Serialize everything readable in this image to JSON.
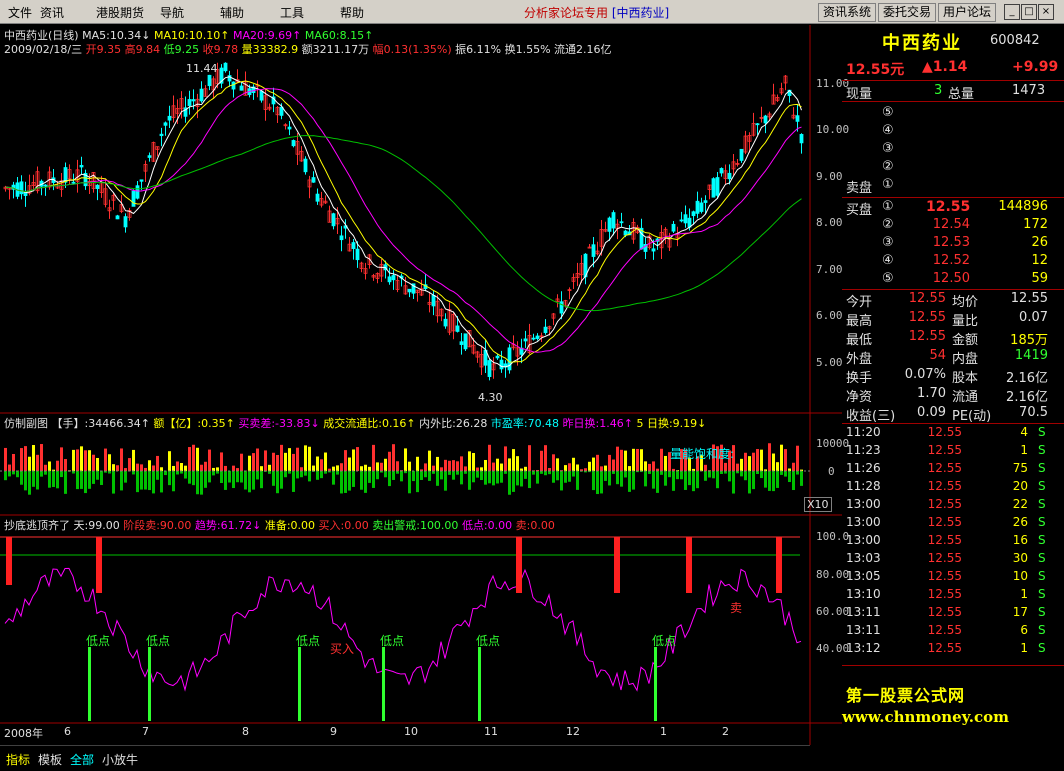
{
  "menu": {
    "items": [
      "文件",
      "资讯",
      "港股期货",
      "导航",
      "辅助",
      "工具",
      "帮助"
    ],
    "center_title": "分析家论坛专用",
    "center_stock": "[中西药业]",
    "buttons": [
      "资讯系统",
      "委托交易",
      "用户论坛"
    ]
  },
  "stock": {
    "name": "中西药业",
    "code": "600842",
    "price": "12.55元",
    "change": "▲1.14",
    "pct": "+9.99"
  },
  "chart_header": {
    "title": "中西药业(日线)",
    "ma5": "MA5:10.34↓",
    "ma10": "MA10:10.10↑",
    "ma20": "MA20:9.69↑",
    "ma60": "MA60:8.15↑",
    "date_line": "2009/02/18/三",
    "open": "开9.35",
    "high": "高9.84",
    "low": "低9.25",
    "close": "收9.78",
    "vol": "量33382.9",
    "amount": "额3211.17万",
    "range": "幅0.13(1.35%)",
    "amp": "振6.11%",
    "turn": "换1.55%",
    "flow": "流通2.16亿"
  },
  "price_annotations": {
    "high": "11.44",
    "low": "4.30"
  },
  "price_axis": [
    "11.00",
    "10.00",
    "9.00",
    "8.00",
    "7.00",
    "6.00",
    "5.00"
  ],
  "sub1": {
    "label": "仿制副图",
    "hand": "【手】:34466.34↑",
    "amt": "额【亿】:0.35↑",
    "diff": "买卖差:-33.83↓",
    "ratio": "成交流通比:0.16↑",
    "inout": "内外比:26.28",
    "pe": "市盈率:70.48",
    "yest": "昨日换:1.46↑",
    "five": "5 日换:9.19↓",
    "axis": [
      "10000",
      "0"
    ],
    "x10": "X10",
    "overlay": "量能饱和度:"
  },
  "sub2": {
    "label": "抄底逃顶齐了",
    "sky": "天:99.00",
    "stage": "阶段卖:90.00",
    "trend": "趋势:61.72↓",
    "prep": "准备:0.00",
    "buy": "买入:0.00",
    "warn": "卖出警戒:100.00",
    "low": "低点:0.00",
    "sell": "卖:0.00",
    "axis": [
      "100.0",
      "80.00",
      "60.00",
      "40.00"
    ],
    "lowpt": "低点",
    "buyin": "买入",
    "sellw": "卖"
  },
  "xaxis": [
    "2008年",
    "6",
    "7",
    "8",
    "9",
    "10",
    "11",
    "12",
    "1",
    "2"
  ],
  "tabs": [
    "指标",
    "模板",
    "全部",
    "小放牛"
  ],
  "quote": {
    "now_vol_label": "现量",
    "now_vol": "3",
    "total_label": "总量",
    "total": "1473",
    "sell": [
      {
        "n": "⑤"
      },
      {
        "n": "④"
      },
      {
        "n": "③"
      },
      {
        "n": "②"
      },
      {
        "label": "卖盘",
        "n": "①"
      }
    ],
    "buy": [
      {
        "label": "买盘",
        "n": "①",
        "p": "12.55",
        "v": "144896"
      },
      {
        "n": "②",
        "p": "12.54",
        "v": "172"
      },
      {
        "n": "③",
        "p": "12.53",
        "v": "26"
      },
      {
        "n": "④",
        "p": "12.52",
        "v": "12"
      },
      {
        "n": "⑤",
        "p": "12.50",
        "v": "59"
      }
    ],
    "stats": [
      [
        "今开",
        "12.55",
        "均价",
        "12.55"
      ],
      [
        "最高",
        "12.55",
        "量比",
        "0.07"
      ],
      [
        "最低",
        "12.55",
        "金额",
        "185万"
      ],
      [
        "外盘",
        "54",
        "内盘",
        "1419"
      ],
      [
        "换手",
        "0.07%",
        "股本",
        "2.16亿"
      ],
      [
        "净资",
        "1.70",
        "流通",
        "2.16亿"
      ],
      [
        "收益(三)",
        "0.09",
        "PE(动)",
        "70.5"
      ]
    ],
    "ticks": [
      [
        "11:20",
        "12.55",
        "4",
        "S"
      ],
      [
        "11:23",
        "12.55",
        "1",
        "S"
      ],
      [
        "11:26",
        "12.55",
        "75",
        "S"
      ],
      [
        "11:28",
        "12.55",
        "20",
        "S"
      ],
      [
        "13:00",
        "12.55",
        "22",
        "S"
      ],
      [
        "13:00",
        "12.55",
        "26",
        "S"
      ],
      [
        "13:00",
        "12.55",
        "16",
        "S"
      ],
      [
        "13:03",
        "12.55",
        "30",
        "S"
      ],
      [
        "13:05",
        "12.55",
        "10",
        "S"
      ],
      [
        "13:10",
        "12.55",
        "1",
        "S"
      ],
      [
        "13:11",
        "12.55",
        "17",
        "S"
      ],
      [
        "13:11",
        "12.55",
        "6",
        "S"
      ],
      [
        "13:12",
        "12.55",
        "1",
        "S"
      ]
    ]
  },
  "watermark": {
    "line1": "第一股票公式网",
    "line2": "www.chnmoney.com"
  },
  "colors": {
    "up": "#ff3030",
    "down": "#00ffff",
    "ma5": "#ffffff",
    "ma10": "#ffff00",
    "ma20": "#ff00ff",
    "ma60": "#00c000"
  }
}
